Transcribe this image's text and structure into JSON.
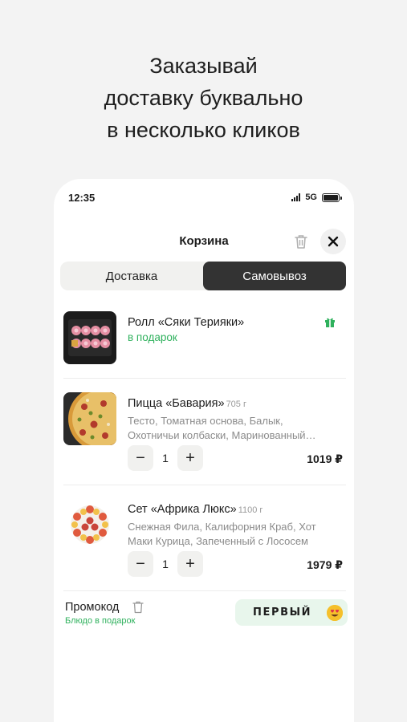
{
  "headline": {
    "line1": "Заказывай",
    "line2": "доставку буквально",
    "line3": "в несколько кликов"
  },
  "status_bar": {
    "time": "12:35",
    "network": "5G"
  },
  "header": {
    "title": "Корзина"
  },
  "delivery_toggle": {
    "options": [
      "Доставка",
      "Самовывоз"
    ],
    "selected": "Самовывоз"
  },
  "cart": {
    "items": [
      {
        "name": "Ролл «Сяки Терияки»",
        "subtitle": "в подарок",
        "image_icon": "roll-image",
        "badge_icon": "gift-icon"
      },
      {
        "name": "Пицца «Бавария»",
        "weight": "705 г",
        "desc_line1": "Тесто, Томатная основа, Балык,",
        "desc_line2": "Охотничьи колбаски, Маринованный…",
        "quantity": "1",
        "price": "1019 ₽",
        "image_icon": "pizza-image"
      },
      {
        "name": "Сет «Африка Люкс»",
        "weight": "1100 г",
        "desc_line1": "Снежная Фила, Калифорния Краб, Хот",
        "desc_line2": "Маки Курица, Запеченный с Лососем",
        "quantity": "1",
        "price": "1979 ₽",
        "image_icon": "sushi-set-image"
      }
    ],
    "minus_label": "−",
    "plus_label": "+"
  },
  "promo": {
    "label": "Промокод",
    "subtitle": "Блюдо в подарок",
    "code": "ПЕРВЫЙ",
    "emoji_icon": "heart-eyes-emoji-icon"
  },
  "colors": {
    "accent_green": "#2fb15d",
    "segment_active": "#333333",
    "promo_bg": "#e8f6ec"
  }
}
